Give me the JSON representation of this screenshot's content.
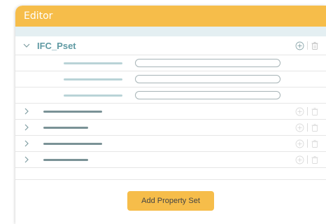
{
  "header": {
    "title": "Editor"
  },
  "pset": {
    "name": "IFC_Pset",
    "expanded": true,
    "add_icon": "plus-circle-icon",
    "delete_icon": "trash-icon"
  },
  "properties_count": 3,
  "collapsed_sets_count": 4,
  "footer": {
    "add_button_label": "Add Property Set"
  },
  "colors": {
    "accent": "#f6bd4a",
    "subbar": "#e4eff2",
    "pset_name": "#5f9aa3",
    "placeholder_bar": "#b9d3d7",
    "name_bar": "#7a9296"
  }
}
